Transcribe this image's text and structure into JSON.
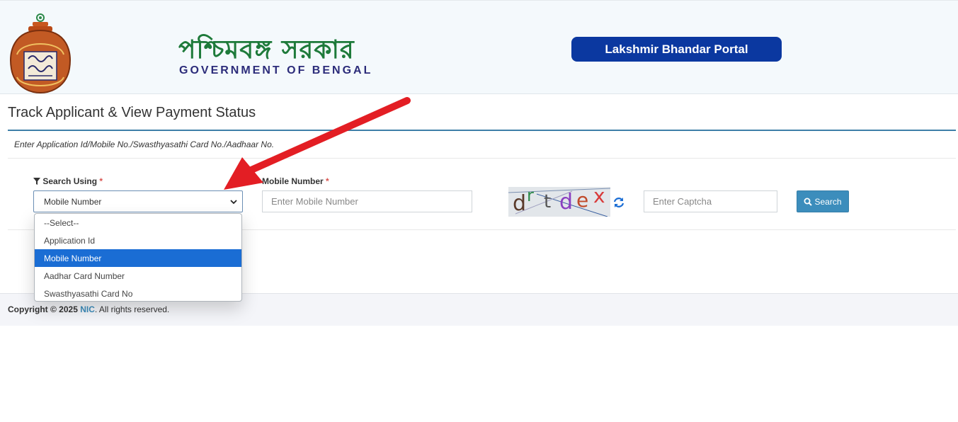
{
  "header": {
    "gov_bengali": "পশ্চিমবঙ্গ সরকার",
    "gov_english": "GOVERNMENT OF BENGAL",
    "portal_name": "Lakshmir Bhandar Portal"
  },
  "main": {
    "title": "Track Applicant & View Payment Status",
    "hint": "Enter Application Id/Mobile No./Swasthyasathi Card No./Aadhaar No."
  },
  "form": {
    "search_using_label": "Search Using",
    "required_mark": "*",
    "search_using_value": "Mobile Number",
    "mobile_label": "Mobile Number",
    "mobile_placeholder": "Enter Mobile Number",
    "captcha_chars": [
      "d",
      "r",
      "t",
      "d",
      "e",
      "x"
    ],
    "captcha_placeholder": "Enter Captcha",
    "search_button": "Search"
  },
  "dropdown": {
    "options": [
      "--Select--",
      "Application Id",
      "Mobile Number",
      "Aadhar Card Number",
      "Swasthyasathi Card No"
    ],
    "selected_index": 2
  },
  "footer": {
    "copyright_prefix": "Copyright © 2025",
    "nic": "NIC",
    "suffix": ". All rights reserved."
  },
  "colors": {
    "portal_badge": "#0b38a0",
    "gov_green": "#1e7a3a",
    "gov_navy": "#2c2c7a",
    "accent_blue": "#3c8dbc",
    "selected_option": "#1a6dd4",
    "arrow_red": "#e31e24"
  },
  "icons": {
    "filter": "filter-icon",
    "chevron": "chevron-down-icon",
    "refresh": "refresh-icon",
    "search": "search-icon",
    "logo": "lakshmir-bhandar-logo",
    "arrow": "annotation-arrow"
  }
}
